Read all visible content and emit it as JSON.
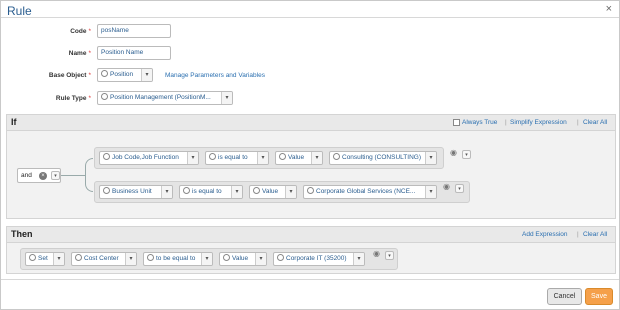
{
  "dialog": {
    "title": "Rule",
    "close_icon": "×",
    "form": {
      "code_label": "Code",
      "code_value": "posName",
      "name_label": "Name",
      "name_value": "Position Name",
      "base_object_label": "Base Object",
      "base_object_value": "Position",
      "manage_link": "Manage Parameters and Variables",
      "rule_type_label": "Rule Type",
      "rule_type_value": "Position Management (PositionM...",
      "required_marker": "*"
    },
    "if_section": {
      "title": "If",
      "always_true": "Always True",
      "simplify": "Simplify Expression",
      "clear_all": "Clear All",
      "separator": "|",
      "operator": "and",
      "conditions": [
        {
          "field": "Job Code,Job Function",
          "comparator": "is equal to",
          "type": "Value",
          "value": "Consulting (CONSULTING)"
        },
        {
          "field": "Business Unit",
          "comparator": "is equal to",
          "type": "Value",
          "value": "Corporate Global Services (NCE..."
        }
      ]
    },
    "then_section": {
      "title": "Then",
      "add_expression": "Add Expression",
      "clear_all": "Clear All",
      "separator": "|",
      "action": {
        "verb": "Set",
        "field": "Cost Center",
        "comparator": "to be equal to",
        "type": "Value",
        "value": "Corporate IT (35200)"
      }
    },
    "buttons": {
      "cancel": "Cancel",
      "save": "Save"
    },
    "icons": {
      "dropdown_caret": "▾",
      "eye": "◉",
      "remove": "×"
    }
  }
}
